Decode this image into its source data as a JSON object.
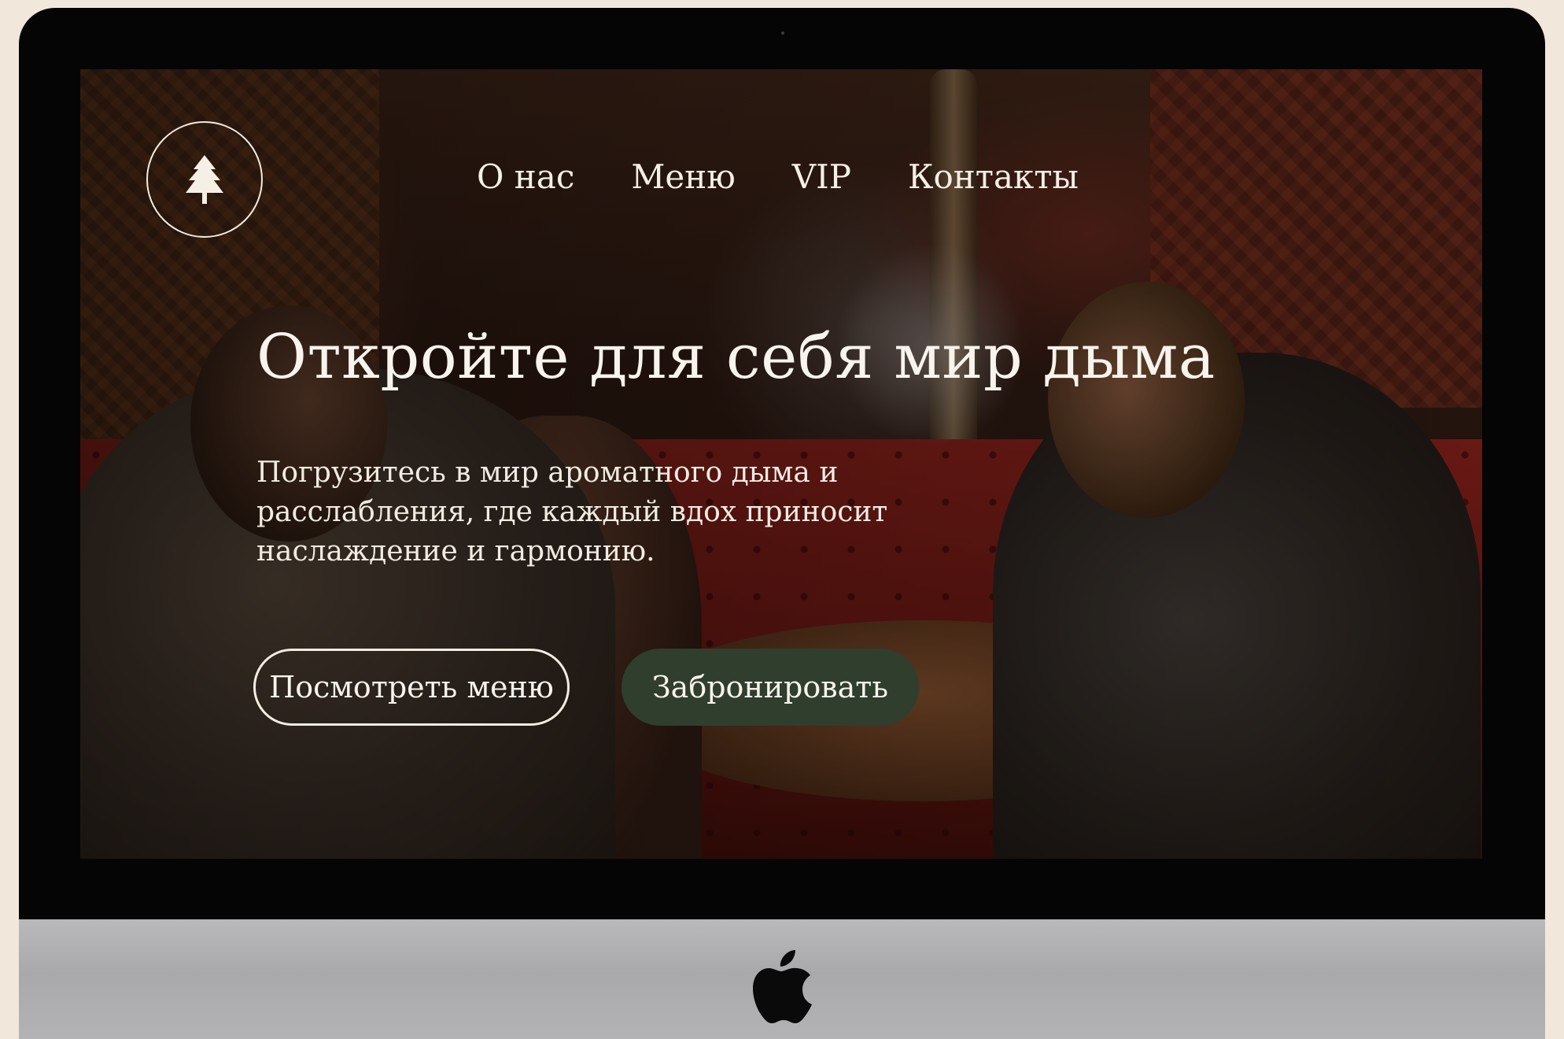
{
  "nav": {
    "items": [
      "О нас",
      "Меню",
      "VIP",
      "Контакты"
    ]
  },
  "hero": {
    "title": "Откройте для себя мир дыма",
    "text": "Погрузитесь в мир ароматного дыма и расслабления, где каждый вдох приносит наслаждение и гармонию."
  },
  "buttons": {
    "menu": "Посмотреть меню",
    "book": "Забронировать"
  },
  "icons": {
    "logo": "pine-tree-icon",
    "device_brand": "apple-logo-icon"
  },
  "colors": {
    "book_button": "#2f3e2d",
    "text": "#f5efe6",
    "backdrop": "#f1e7db"
  }
}
